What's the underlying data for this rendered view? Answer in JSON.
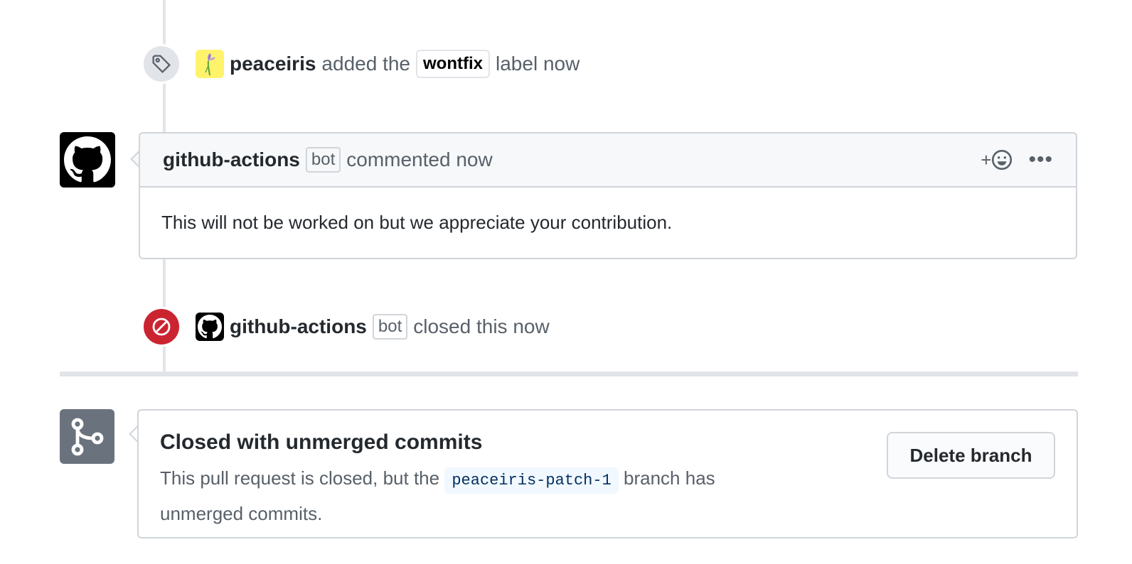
{
  "label_event": {
    "author": "peaceiris",
    "action_pre": "added the",
    "label": "wontfix",
    "action_post": "label now"
  },
  "comment": {
    "author": "github-actions",
    "bot_tag": "bot",
    "action": "commented now",
    "reaction_plus": "+",
    "more": "•••",
    "body": "This will not be worked on but we appreciate your contribution."
  },
  "close_event": {
    "author": "github-actions",
    "bot_tag": "bot",
    "action": "closed this now"
  },
  "merge_status": {
    "title": "Closed with unmerged commits",
    "desc_pre": "This pull request is closed, but the",
    "branch": "peaceiris-patch-1",
    "desc_post": "branch has unmerged commits.",
    "delete_button": "Delete branch"
  },
  "colors": {
    "closed_badge": "#cb2431",
    "branch_code_text": "#032f62",
    "branch_code_bg": "#f1f8ff",
    "merge_icon_bg": "#6a737d"
  },
  "icons": {
    "label_event": "tag-icon",
    "close_event": "circle-slash-icon",
    "merge_status": "git-branch-icon",
    "avatar": "github-octocat-icon",
    "reaction": "smiley-icon"
  }
}
